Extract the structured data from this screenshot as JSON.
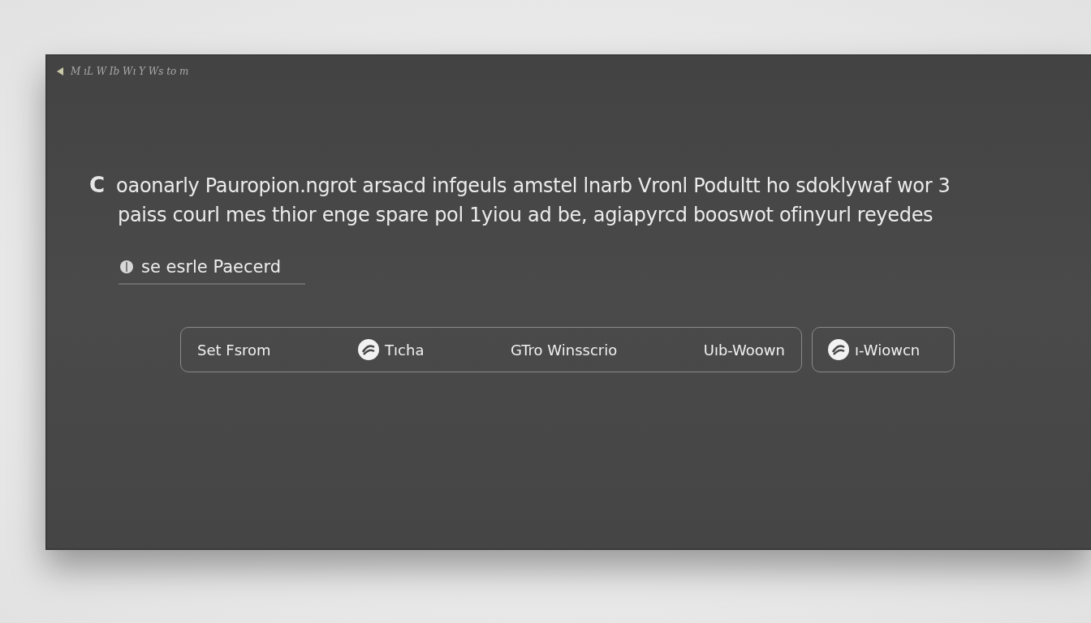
{
  "breadcrumb": {
    "text": "M ıL W Ib Wı Y Ws to m"
  },
  "message": {
    "lead": "C",
    "lines": [
      "oaonarly Pauropion.ngrot arsacd infgeuls amstel lnarb Vronl Podultt ho sdoklywaf wor 3",
      "paiss courl mes thior enge spare pol 1yiou ad be, agiapyrcd booswot ofinyurl reyedes"
    ]
  },
  "field": {
    "placeholder": "se esrle Paecerd"
  },
  "button_group": [
    {
      "label": "Set Fsrom",
      "kind": "text"
    },
    {
      "label": "Tıcha",
      "kind": "icon"
    },
    {
      "label": "GTro Winsscrio",
      "kind": "text"
    },
    {
      "label": "Uıb-Woown",
      "kind": "text"
    }
  ],
  "extra_button": {
    "label": "ı-Wiowcn"
  }
}
